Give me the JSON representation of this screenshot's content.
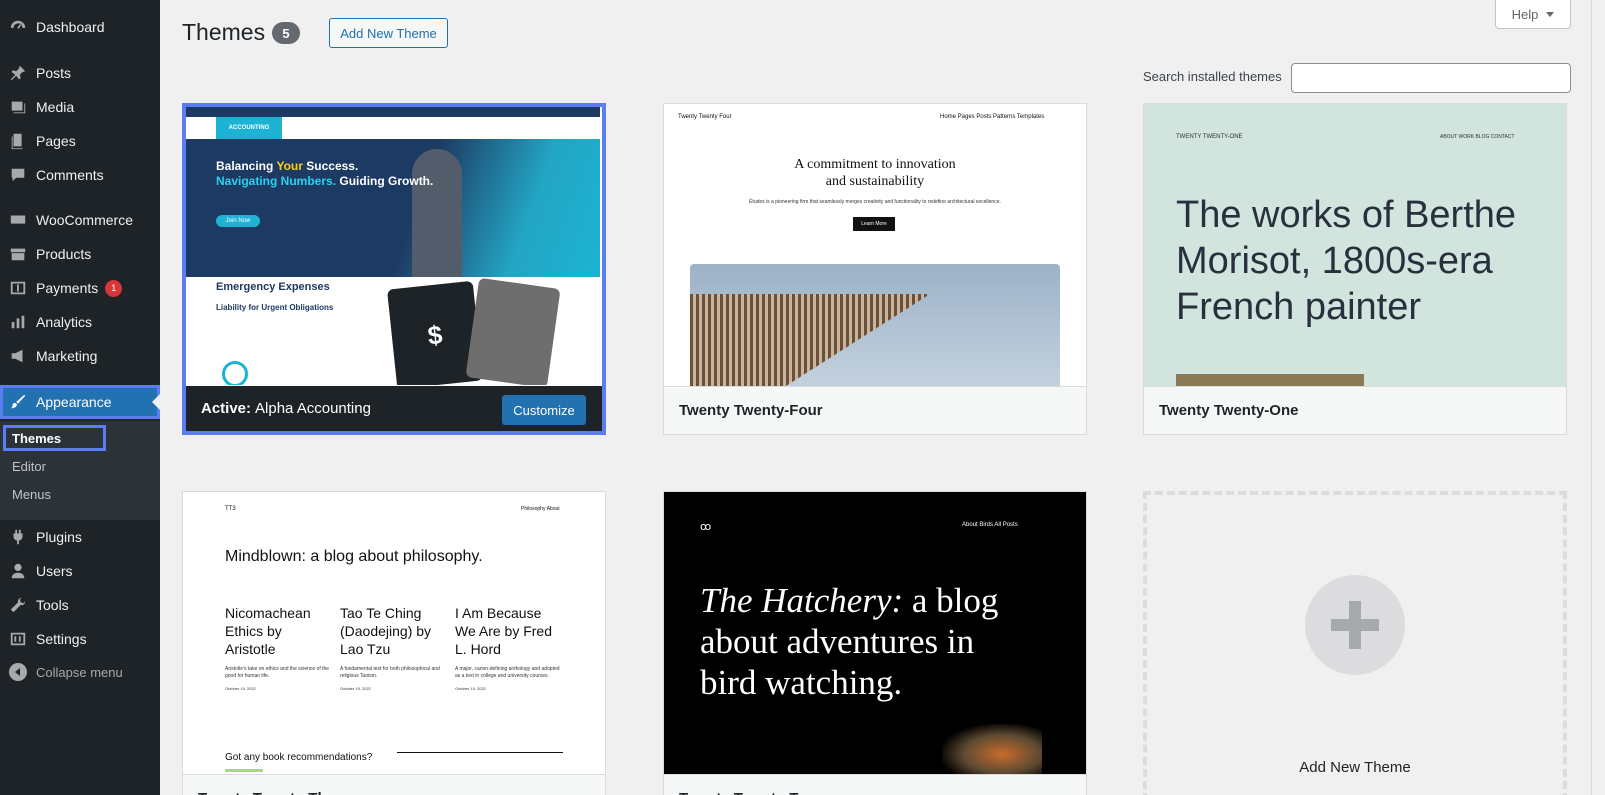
{
  "sidebar": {
    "items": [
      {
        "label": "Dashboard",
        "icon": "dashboard-icon"
      },
      {
        "label": "Posts",
        "icon": "pin-icon"
      },
      {
        "label": "Media",
        "icon": "media-icon"
      },
      {
        "label": "Pages",
        "icon": "pages-icon"
      },
      {
        "label": "Comments",
        "icon": "comment-icon"
      },
      {
        "label": "WooCommerce",
        "icon": "woocommerce-icon"
      },
      {
        "label": "Products",
        "icon": "archive-icon"
      },
      {
        "label": "Payments",
        "icon": "dollar-icon",
        "badge": "1"
      },
      {
        "label": "Analytics",
        "icon": "bar-chart-icon"
      },
      {
        "label": "Marketing",
        "icon": "megaphone-icon"
      },
      {
        "label": "Appearance",
        "icon": "paintbrush-icon"
      },
      {
        "label": "Plugins",
        "icon": "plug-icon"
      },
      {
        "label": "Users",
        "icon": "user-icon"
      },
      {
        "label": "Tools",
        "icon": "wrench-icon"
      },
      {
        "label": "Settings",
        "icon": "settings-icon"
      }
    ],
    "submenu": [
      "Themes",
      "Editor",
      "Menus"
    ],
    "collapse_label": "Collapse menu"
  },
  "header": {
    "title": "Themes",
    "count": "5",
    "add_new_label": "Add New Theme",
    "help_label": "Help"
  },
  "search": {
    "label": "Search installed themes",
    "value": "",
    "placeholder": ""
  },
  "themes": [
    {
      "name": "Alpha Accounting",
      "active_prefix": "Active:",
      "action": "Customize"
    },
    {
      "name": "Twenty Twenty-Four"
    },
    {
      "name": "Twenty Twenty-One"
    },
    {
      "name": "Twenty Twenty-Three"
    },
    {
      "name": "Twenty Twenty-Two"
    }
  ],
  "previews": {
    "accounting": {
      "logo": "ACCOUNTING",
      "hero_line1_a": "Balancing ",
      "hero_line1_b": "Your",
      "hero_line1_c": " Success.",
      "hero_line2_a": "Navigating Numbers.",
      "hero_line2_b": " Guiding Growth.",
      "join": "Join Now",
      "emergency": "Emergency Expenses",
      "liability": "Liability for Urgent Obligations",
      "card_text": "$"
    },
    "tt4": {
      "site": "Twenty Twenty Four",
      "nav": "Home   Pages   Posts   Patterns   Templates",
      "head_1": "A commitment to innovation",
      "head_2": "and sustainability",
      "sub": "Études is a pioneering firm that seamlessly merges creativity and functionality to redefine architectural excellence.",
      "btn": "Learn More"
    },
    "tt1": {
      "site": "TWENTY TWENTY-ONE",
      "nav": "ABOUT   WORK   BLOG   CONTACT",
      "head": "The works of Berthe Morisot, 1800s-era French painter"
    },
    "tt3": {
      "site": "TT3",
      "nav": "Philosophy   About",
      "head": "Mindblown: a blog about philosophy.",
      "col1": "Nicomachean Ethics by Aristotle",
      "col2": "Tao Te Ching (Daodejing) by Lao Tzu",
      "col3": "I Am Because We Are by Fred L. Hord",
      "small1": "Aristotle's take on ethics and the science of the good for human life.",
      "small2": "A fundamental text for both philosophical and religious Taoism.",
      "small3": "A major, canon-defining anthology and adopted as a text in college and university courses.",
      "date": "October 19, 2022",
      "question": "Got any book recommendations?"
    },
    "tt2": {
      "logo": "ꝏ",
      "nav": "About     Birds     All Posts",
      "head_italic": "The Hatchery:",
      "head_rest": " a blog about adventures in bird watching."
    }
  },
  "add_new_card_label": "Add New Theme",
  "colors": {
    "sidebar_bg": "#1d2327",
    "accent": "#2271b1",
    "focus_outline": "#5b7cf2",
    "badge_red": "#d63638"
  }
}
